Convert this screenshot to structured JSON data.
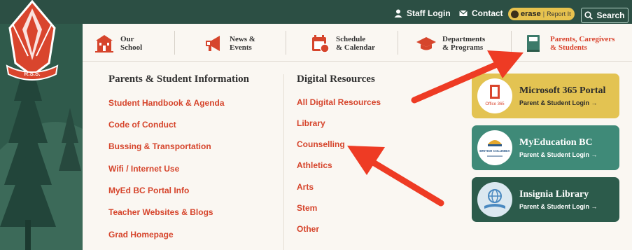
{
  "utility": {
    "staff_login": "Staff Login",
    "contact": "Contact",
    "erase": "erase",
    "report_it": "Report It",
    "search": "Search"
  },
  "crest": {
    "text": "R.S.S."
  },
  "nav": [
    {
      "line1": "Our",
      "line2": "School",
      "icon": "school-icon"
    },
    {
      "line1": "News &",
      "line2": "Events",
      "icon": "megaphone-icon"
    },
    {
      "line1": "Schedule",
      "line2": "& Calendar",
      "icon": "calendar-icon"
    },
    {
      "line1": "Departments",
      "line2": "& Programs",
      "icon": "graduation-cap-icon"
    },
    {
      "line1": "Parents, Caregivers",
      "line2": "& Students",
      "icon": "book-icon"
    }
  ],
  "dropdown": {
    "col1_title": "Parents & Student Information",
    "col1_links": [
      "Student Handbook & Agenda",
      "Code of Conduct",
      "Bussing & Transportation",
      "Wifi / Internet Use",
      "MyEd BC Portal Info",
      "Teacher Websites & Blogs",
      "Grad Homepage"
    ],
    "col2_title": "Digital Resources",
    "col2_links": [
      "All Digital Resources",
      "Library",
      "Counselling",
      "Athletics",
      "Arts",
      "Stem",
      "Other"
    ],
    "cards": [
      {
        "title": "Microsoft 365 Portal",
        "sub": "Parent & Student Login →",
        "logo_text": "Office 365",
        "color": "#e3c352"
      },
      {
        "title": "MyEducation BC",
        "sub": "Parent & Student Login →",
        "logo_text": "BRITISH COLUMBIA",
        "color": "#3f8a78"
      },
      {
        "title": "Insignia Library",
        "sub": "Parent & Student Login →",
        "logo_text": "",
        "color": "#2c5b4b"
      }
    ]
  },
  "colors": {
    "accent": "#d6452c",
    "dark_green": "#2c4f44",
    "cream": "#faf7f2",
    "annotation_red": "#ee3b24"
  }
}
